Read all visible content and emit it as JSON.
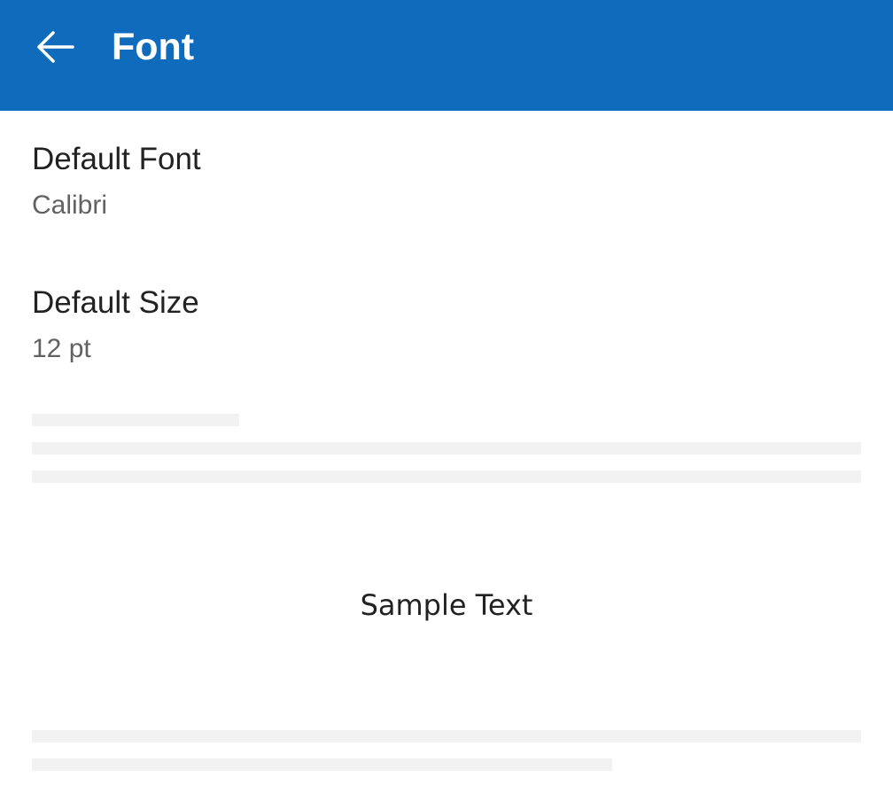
{
  "header": {
    "title": "Font",
    "back_icon": "arrow-left-icon",
    "background_color": "#0f6cbd",
    "text_color": "#ffffff"
  },
  "settings": [
    {
      "label": "Default Font",
      "value": "Calibri"
    },
    {
      "label": "Default Size",
      "value": "12 pt"
    }
  ],
  "preview": {
    "sample_text": "Sample Text"
  },
  "colors": {
    "label": "#222222",
    "value": "#616161",
    "placeholder": "#f2f2f2"
  }
}
